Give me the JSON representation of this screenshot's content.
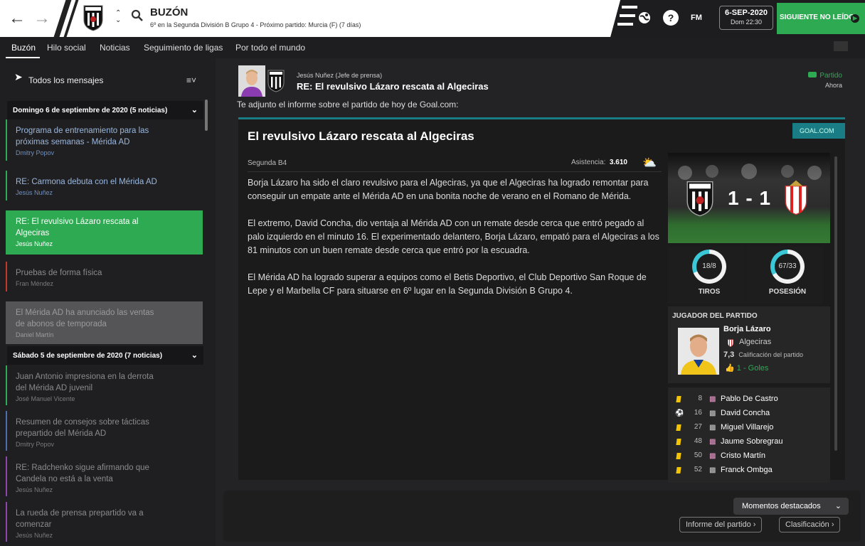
{
  "topbar": {
    "title": "BUZÓN",
    "subtitle": "6º en la Segunda División B Grupo 4 - Próximo partido: Murcia (F)  (7 días)",
    "fm_label": "FM",
    "help_label": "?",
    "date": "6-SEP-2020",
    "day_time": "Dom 22:30",
    "next_button": "SIGUIENTE NO LEÍDO"
  },
  "tabs": [
    "Buzón",
    "Hilo social",
    "Noticias",
    "Seguimiento de ligas",
    "Por todo el mundo"
  ],
  "sidebar": {
    "all_messages": "Todos los mensajes",
    "groups": [
      {
        "label": "Domingo 6 de septiembre de 2020 (5 noticias)"
      },
      {
        "label": "Sábado 5 de septiembre de 2020 (7 noticias)"
      }
    ],
    "messages": [
      {
        "subject": "Programa de entrenamiento para las próximas semanas - Mérida AD",
        "from": "Dmitry Popov"
      },
      {
        "subject": "RE: Carmona debuta con el Mérida AD",
        "from": "Jesús Nuñez"
      },
      {
        "subject": "RE: El revulsivo Lázaro rescata al Algeciras",
        "from": "Jesús Nuñez"
      },
      {
        "subject": "Pruebas de forma física",
        "from": "Fran Méndez"
      },
      {
        "subject": "El Mérida AD ha anunciado las ventas de abonos de temporada",
        "from": "Daniel Martín"
      },
      {
        "subject": "Juan Antonio impresiona en la derrota del Mérida AD juvenil",
        "from": "José Manuel Vicente"
      },
      {
        "subject": "Resumen de consejos sobre tácticas prepartido del Mérida AD",
        "from": "Dmitry Popov"
      },
      {
        "subject": "RE: Radchenko sigue afirmando que Candela no está a la venta",
        "from": "Jesús Nuñez"
      },
      {
        "subject": "La rueda de prensa prepartido va a comenzar",
        "from": "Jesús Nuñez"
      }
    ]
  },
  "message": {
    "sender": "Jesús Nuñez  (Jefe de prensa)",
    "subject": "RE: El revulsivo Lázaro rescata al Algeciras",
    "tag": "Partido",
    "time": "Ahora",
    "intro": "Te adjunto el informe sobre el partido de hoy de Goal.com:"
  },
  "article": {
    "source": "GOAL.COM",
    "title": "El revulsivo Lázaro rescata al Algeciras",
    "league": "Segunda B4",
    "attendance_label": "Asistencia:",
    "attendance": "3.610",
    "paragraphs": [
      "Borja Lázaro ha sido el claro revulsivo para el Algeciras, ya que el Algeciras ha logrado remontar para conseguir un empate ante el Mérida AD en una bonita noche de verano en el Romano de Mérida.",
      "El extremo, David Concha, dio ventaja al Mérida AD con un remate desde cerca que entró pegado al palo izquierdo en el minuto 16. El experimentado delantero, Borja Lázaro, empató para el Algeciras a los 81 minutos con un buen remate desde cerca que entró por la escuadra.",
      "El Mérida AD ha logrado superar a equipos como el Betis Deportivo, el Club Deportivo San Roque de Lepe y el Marbella CF para situarse en 6º lugar en la Segunda División B Grupo 4."
    ]
  },
  "match": {
    "score": "1 - 1",
    "stats": [
      {
        "label": "TIROS",
        "value": "18/8",
        "home_fraction": 0.69
      },
      {
        "label": "POSESIÓN",
        "value": "67/33",
        "home_fraction": 0.67
      }
    ],
    "motm": {
      "header": "JUGADOR DEL PARTIDO",
      "name": "Borja Lázaro",
      "club": "Algeciras",
      "rating": "7,3",
      "rating_label": "Calificación del partido",
      "goals": "1 - Goles"
    },
    "events": [
      {
        "type": "yellow-card",
        "minute": "8",
        "team": "algeciras",
        "player": "Pablo De Castro"
      },
      {
        "type": "goal",
        "minute": "16",
        "team": "merida",
        "player": "David Concha"
      },
      {
        "type": "yellow-card",
        "minute": "27",
        "team": "merida",
        "player": "Miguel Villarejo"
      },
      {
        "type": "yellow-card",
        "minute": "48",
        "team": "algeciras",
        "player": "Jaume Sobregrau"
      },
      {
        "type": "yellow-card",
        "minute": "50",
        "team": "algeciras",
        "player": "Cristo Martín"
      },
      {
        "type": "yellow-card",
        "minute": "52",
        "team": "merida",
        "player": "Franck Ombga"
      }
    ]
  },
  "footer": {
    "highlights": "Momentos destacados",
    "match_report": "Informe del partido",
    "standings": "Clasificación"
  },
  "colors": {
    "accent": "#2eab52",
    "goal_teal": "#1a7d86",
    "ring": "#3bc8d6",
    "yellow_card": "#f2c500"
  }
}
